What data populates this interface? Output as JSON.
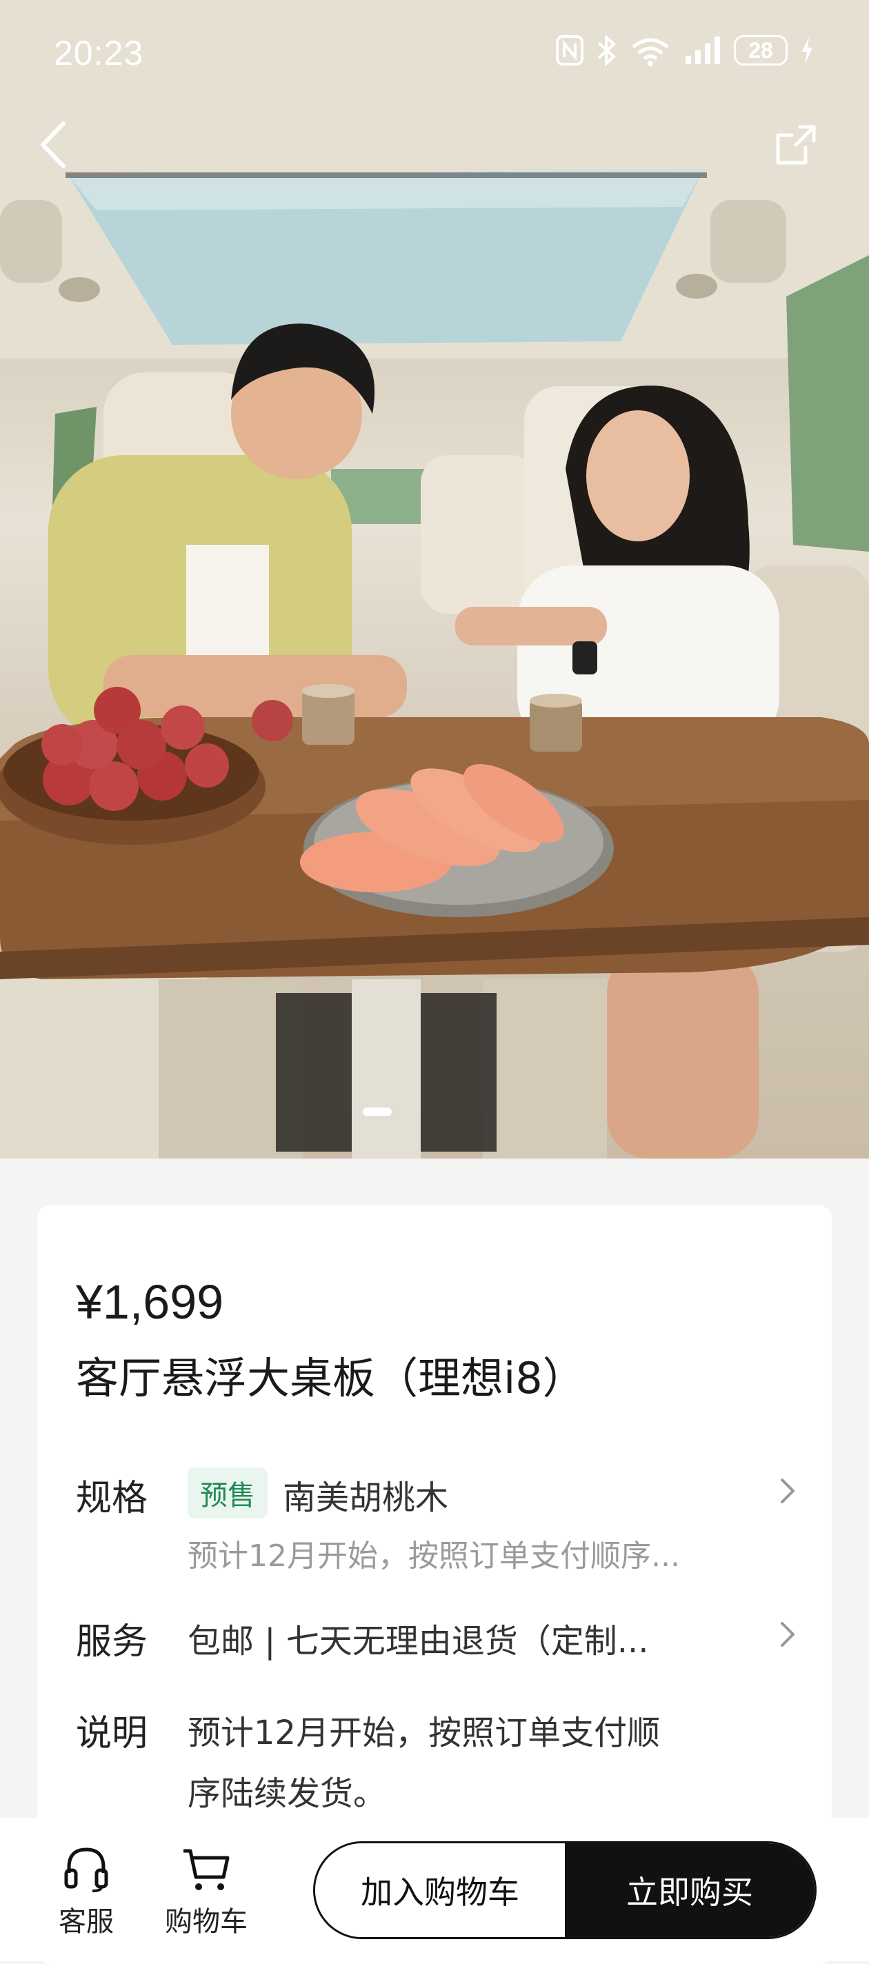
{
  "status_bar": {
    "time": "20:23",
    "battery": "28",
    "icons": [
      "nfc-icon",
      "bluetooth-icon",
      "wifi-icon",
      "signal-icon",
      "charging-icon"
    ]
  },
  "header": {
    "back_icon": "chevron-left-icon",
    "share_icon": "share-icon"
  },
  "gallery": {
    "current_index": 1
  },
  "product": {
    "price": "¥1,699",
    "title": "客厅悬浮大桌板（理想i8）"
  },
  "spec": {
    "label": "规格",
    "badge": "预售",
    "value": "南美胡桃木",
    "note": "预计12月开始，按照订单支付顺序..."
  },
  "service": {
    "label": "服务",
    "value": "包邮 | 七天无理由退货（定制..."
  },
  "description": {
    "label": "说明",
    "line1": "预计12月开始，按照订单支付顺",
    "line2": "序陆续发货。"
  },
  "bottom_bar": {
    "service_label": "客服",
    "cart_label": "购物车",
    "add_to_cart": "加入购物车",
    "buy_now": "立即购买"
  },
  "colors": {
    "badge_bg": "#eaf5ef",
    "badge_text": "#1f8a57",
    "primary_dark": "#111111"
  }
}
